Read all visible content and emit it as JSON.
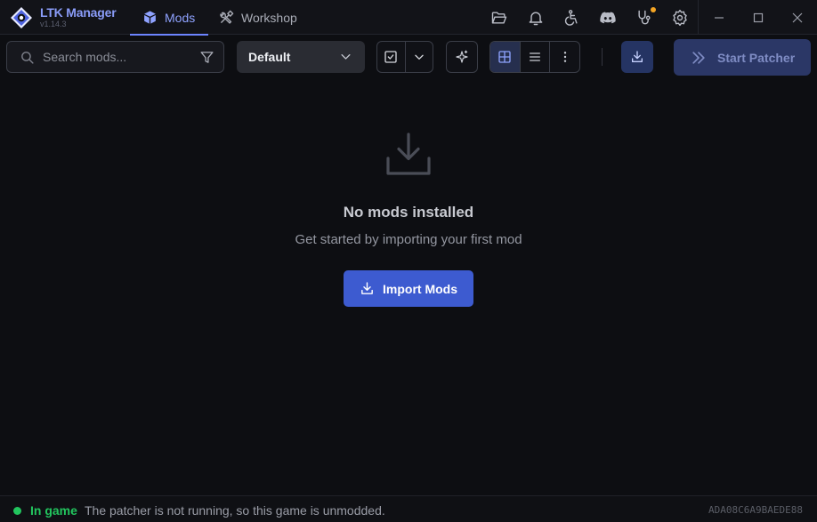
{
  "app": {
    "name": "LTK Manager",
    "version": "v1.14.3"
  },
  "tabs": [
    {
      "label": "Mods",
      "icon": "mods-box-icon",
      "active": true
    },
    {
      "label": "Workshop",
      "icon": "workshop-tools-icon",
      "active": false
    }
  ],
  "titlebar_icons": [
    "folder-open-icon",
    "bell-icon",
    "accessibility-icon",
    "discord-icon",
    "stethoscope-icon",
    "gear-icon"
  ],
  "window_controls": [
    "minimize-icon",
    "maximize-icon",
    "close-icon"
  ],
  "toolbar": {
    "search_placeholder": "Search mods...",
    "search_value": "",
    "profile": "Default",
    "start_patcher_label": "Start Patcher"
  },
  "empty_state": {
    "title": "No mods installed",
    "subtitle": "Get started by importing your first mod",
    "button_label": "Import Mods"
  },
  "status": {
    "state": "In game",
    "message": "The patcher is not running, so this game is unmodded.",
    "id": "ADA08C6A9BAEDE88"
  },
  "colors": {
    "accent": "#6c84ff",
    "primary_button": "#3d5bd0",
    "status_ok": "#22c55e",
    "notification_dot": "#f5a524",
    "background": "#0d0e12"
  }
}
